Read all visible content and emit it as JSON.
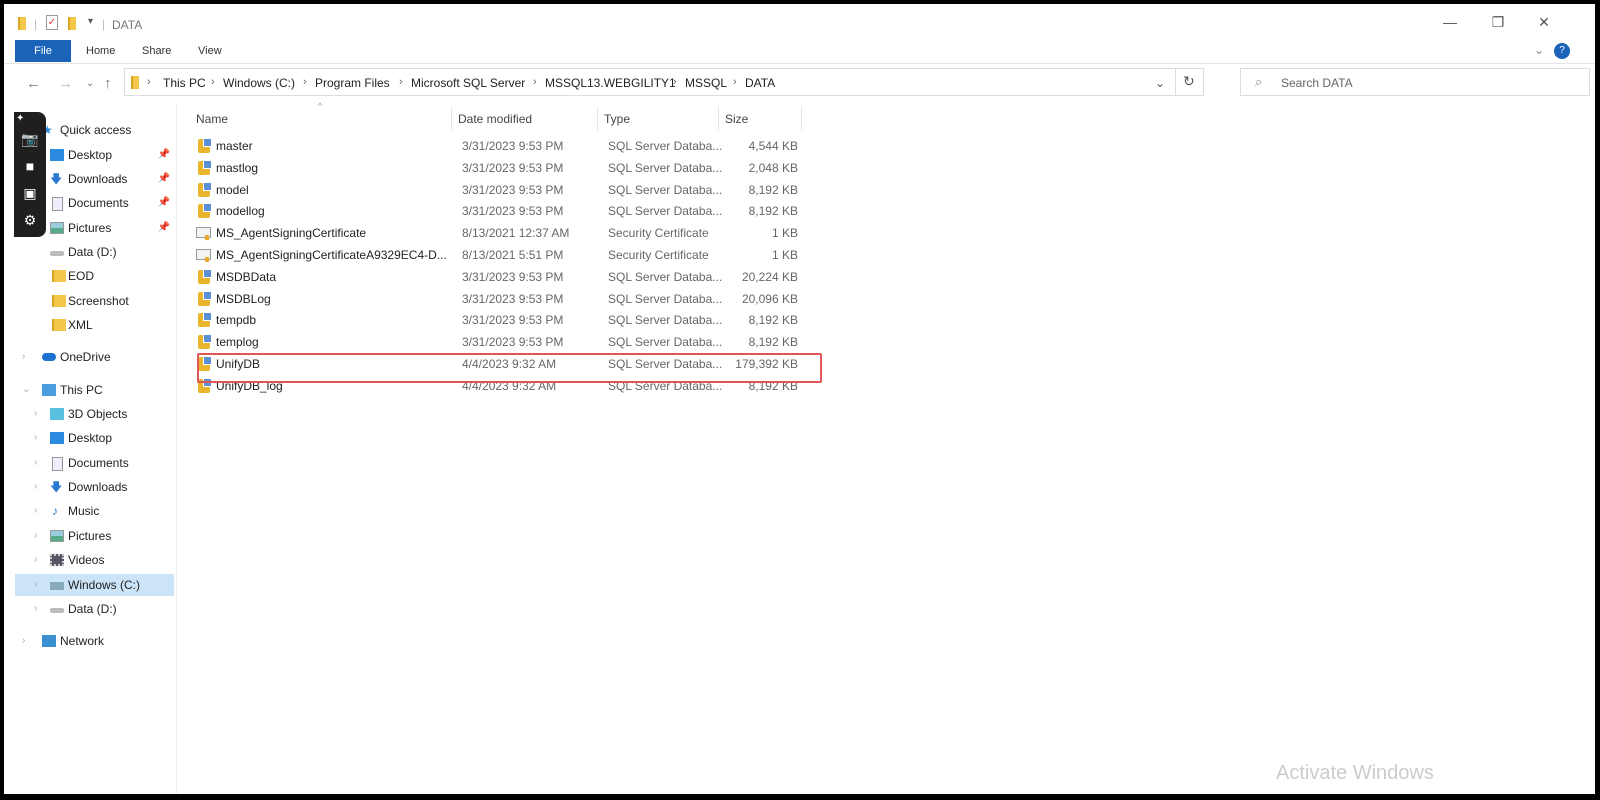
{
  "window": {
    "title": "DATA",
    "controls": {
      "minimize": "—",
      "maximize": "❐",
      "close": "✕"
    }
  },
  "ribbon": {
    "tabs": [
      "File",
      "Home",
      "Share",
      "View"
    ]
  },
  "address": {
    "crumbs": [
      "This PC",
      "Windows (C:)",
      "Program Files",
      "Microsoft SQL Server",
      "MSSQL13.WEBGILITY1",
      "MSSQL",
      "DATA"
    ]
  },
  "search": {
    "placeholder": "Search DATA"
  },
  "sidebar": {
    "quick_access": "Quick access",
    "quick_items": [
      "Desktop",
      "Downloads",
      "Documents",
      "Pictures",
      "Data (D:)",
      "EOD",
      "Screenshot",
      "XML"
    ],
    "onedrive": "OneDrive",
    "this_pc": "This PC",
    "pc_items": [
      "3D Objects",
      "Desktop",
      "Documents",
      "Downloads",
      "Music",
      "Pictures",
      "Videos",
      "Windows (C:)",
      "Data (D:)"
    ],
    "network": "Network"
  },
  "columns": [
    "Name",
    "Date modified",
    "Type",
    "Size"
  ],
  "files": [
    {
      "name": "master",
      "date": "3/31/2023 9:53 PM",
      "type": "SQL Server Databa...",
      "size": "4,544 KB",
      "icon": "db"
    },
    {
      "name": "mastlog",
      "date": "3/31/2023 9:53 PM",
      "type": "SQL Server Databa...",
      "size": "2,048 KB",
      "icon": "db"
    },
    {
      "name": "model",
      "date": "3/31/2023 9:53 PM",
      "type": "SQL Server Databa...",
      "size": "8,192 KB",
      "icon": "db"
    },
    {
      "name": "modellog",
      "date": "3/31/2023 9:53 PM",
      "type": "SQL Server Databa...",
      "size": "8,192 KB",
      "icon": "db"
    },
    {
      "name": "MS_AgentSigningCertificate",
      "date": "8/13/2021 12:37 AM",
      "type": "Security Certificate",
      "size": "1 KB",
      "icon": "cert"
    },
    {
      "name": "MS_AgentSigningCertificateA9329EC4-D...",
      "date": "8/13/2021 5:51 PM",
      "type": "Security Certificate",
      "size": "1 KB",
      "icon": "cert"
    },
    {
      "name": "MSDBData",
      "date": "3/31/2023 9:53 PM",
      "type": "SQL Server Databa...",
      "size": "20,224 KB",
      "icon": "db"
    },
    {
      "name": "MSDBLog",
      "date": "3/31/2023 9:53 PM",
      "type": "SQL Server Databa...",
      "size": "20,096 KB",
      "icon": "db"
    },
    {
      "name": "tempdb",
      "date": "3/31/2023 9:53 PM",
      "type": "SQL Server Databa...",
      "size": "8,192 KB",
      "icon": "db"
    },
    {
      "name": "templog",
      "date": "3/31/2023 9:53 PM",
      "type": "SQL Server Databa...",
      "size": "8,192 KB",
      "icon": "db"
    },
    {
      "name": "UnifyDB",
      "date": "4/4/2023 9:32 AM",
      "type": "SQL Server Databa...",
      "size": "179,392 KB",
      "icon": "db"
    },
    {
      "name": "UnifyDB_log",
      "date": "4/4/2023 9:32 AM",
      "type": "SQL Server Databa...",
      "size": "8,192 KB",
      "icon": "db"
    }
  ],
  "watermark": "Activate Windows",
  "colors": {
    "file_tab": "#1a63b8",
    "highlight": "#e05555",
    "selected_nav": "#cce4f7"
  }
}
